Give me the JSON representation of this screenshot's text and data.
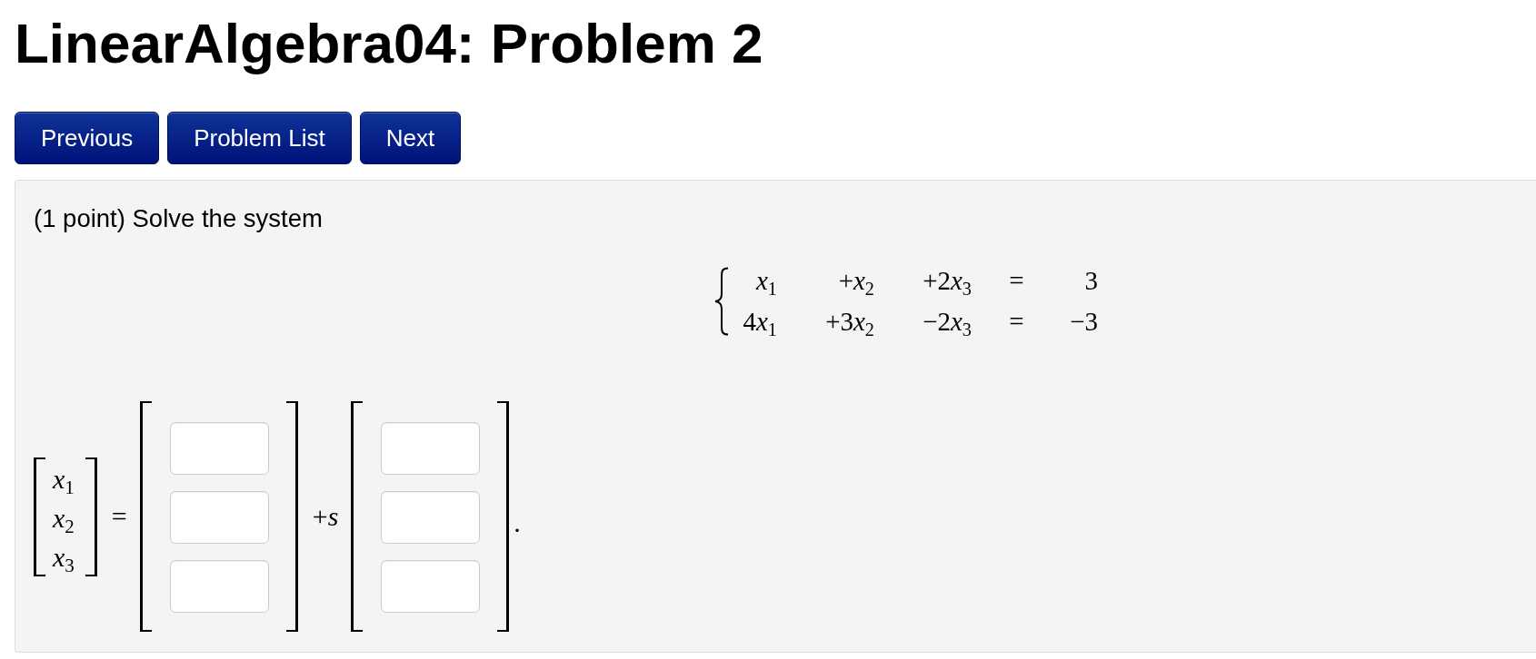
{
  "page": {
    "title": "LinearAlgebra04: Problem 2"
  },
  "nav_buttons": [
    {
      "label": "Previous"
    },
    {
      "label": "Problem List"
    },
    {
      "label": "Next"
    }
  ],
  "problem": {
    "statement": "(1 point) Solve the system",
    "system": {
      "rows": [
        [
          {
            "kind": "variable",
            "symbol": "x",
            "index": "1"
          },
          {
            "kind": "variable",
            "coefficient": "+",
            "symbol": "x",
            "index": "2"
          },
          {
            "kind": "variable",
            "coefficient": "+2",
            "symbol": "x",
            "index": "3"
          },
          {
            "kind": "relation",
            "text": "="
          },
          {
            "kind": "constant",
            "text": "3"
          }
        ],
        [
          {
            "kind": "variable",
            "coefficient": "4",
            "symbol": "x",
            "index": "1"
          },
          {
            "kind": "variable",
            "coefficient": "+3",
            "symbol": "x",
            "index": "2"
          },
          {
            "kind": "variable",
            "coefficient": "−2",
            "symbol": "x",
            "index": "3"
          },
          {
            "kind": "relation",
            "text": "="
          },
          {
            "kind": "constant",
            "text": "−3"
          }
        ]
      ]
    },
    "vector_equation": [
      {
        "kind": "vector",
        "entries": [
          {
            "kind": "symbol",
            "symbol": "x",
            "index": "1"
          },
          {
            "kind": "symbol",
            "symbol": "x",
            "index": "2"
          },
          {
            "kind": "symbol",
            "symbol": "x",
            "index": "3"
          }
        ]
      },
      {
        "kind": "operator",
        "text": "="
      },
      {
        "kind": "vector",
        "entries": [
          {
            "kind": "input"
          },
          {
            "kind": "input"
          },
          {
            "kind": "input"
          }
        ]
      },
      {
        "kind": "operator",
        "text": "+*s*"
      },
      {
        "kind": "vector",
        "entries": [
          {
            "kind": "input"
          },
          {
            "kind": "input"
          },
          {
            "kind": "input"
          }
        ]
      },
      {
        "kind": "punctuation",
        "text": "."
      }
    ]
  }
}
